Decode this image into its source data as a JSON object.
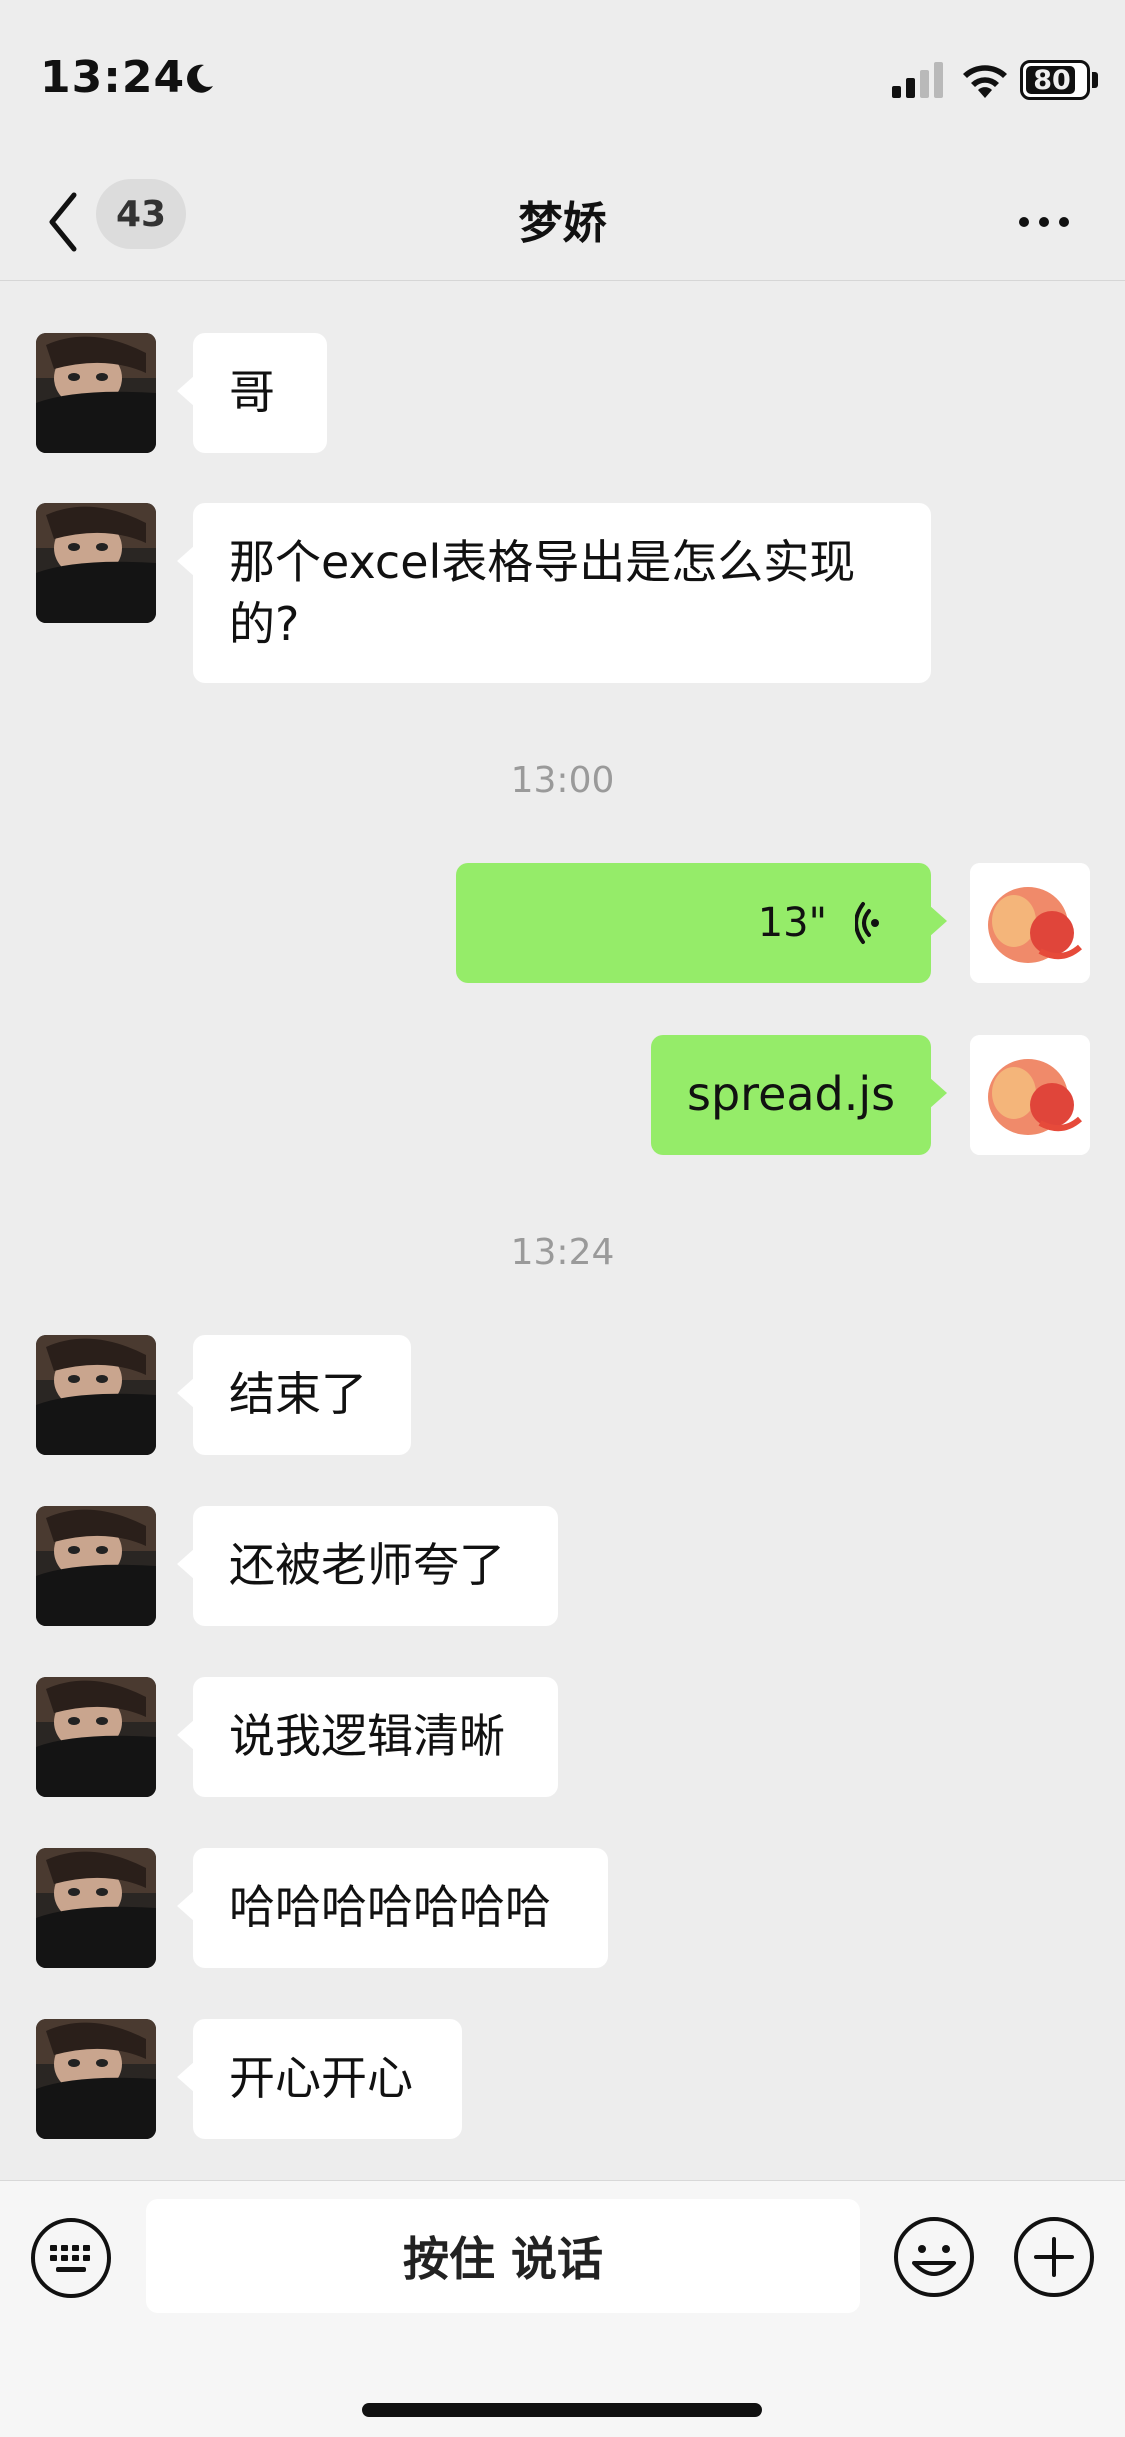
{
  "status": {
    "time": "13:24",
    "battery": "80"
  },
  "nav": {
    "unread": "43",
    "title": "梦娇"
  },
  "timestamps": [
    "13:00",
    "13:24"
  ],
  "messages": {
    "m1": "哥",
    "m2": "那个excel表格导出是怎么实现的?",
    "voice_duration": "13\"",
    "m4": "spread.js",
    "m5": "结束了",
    "m6": "还被老师夸了",
    "m7": "说我逻辑清晰",
    "m8": "哈哈哈哈哈哈哈",
    "m9": "开心开心"
  },
  "input": {
    "hold_to_talk": "按住 说话"
  },
  "colors": {
    "my_bubble": "#95ec69",
    "their_bubble": "#ffffff",
    "background": "#ededed"
  }
}
